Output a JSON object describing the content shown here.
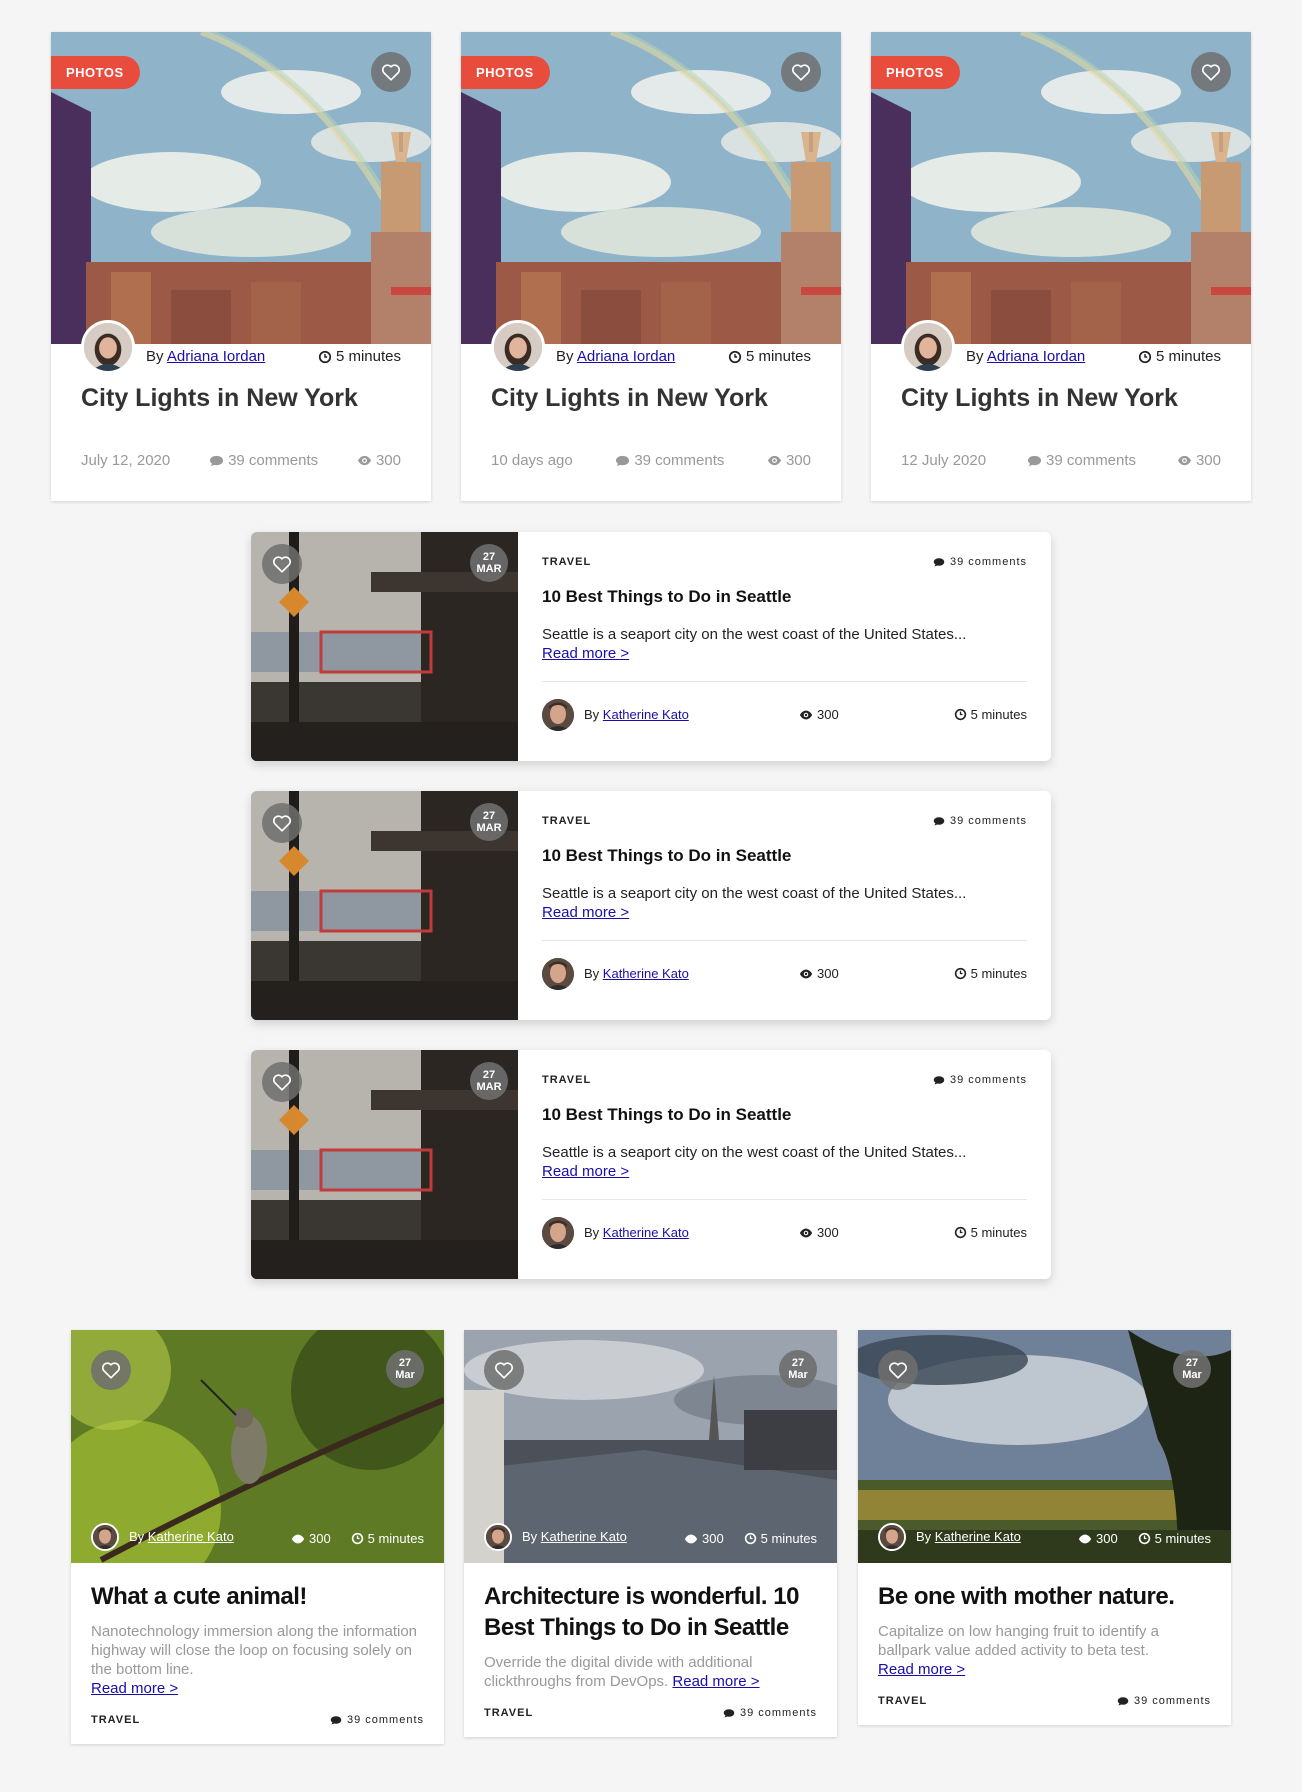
{
  "top_cards": [
    {
      "badge": "PHOTOS",
      "by": "By",
      "author": "Adriana Iordan",
      "read_time": "5 minutes",
      "title": "City Lights in New York",
      "date": "July 12, 2020",
      "comments": "39 comments",
      "views": "300"
    },
    {
      "badge": "PHOTOS",
      "by": "By",
      "author": "Adriana Iordan",
      "read_time": "5 minutes",
      "title": "City Lights in New York",
      "date": "10 days ago",
      "comments": "39 comments",
      "views": "300"
    },
    {
      "badge": "PHOTOS",
      "by": "By",
      "author": "Adriana Iordan",
      "read_time": "5 minutes",
      "title": "City Lights in New York",
      "date": "12 July 2020",
      "comments": "39 comments",
      "views": "300"
    }
  ],
  "horizontal_cards": [
    {
      "category": "TRAVEL",
      "comments": "39 comments",
      "title": "10 Best Things to Do in Seattle",
      "excerpt": "Seattle is a seaport city on the west coast of the United States...",
      "read_more": "Read more >",
      "by": "By",
      "author": "Katherine Kato",
      "views": "300",
      "read_time": "5 minutes",
      "date_day": "27",
      "date_month": "MAR"
    },
    {
      "category": "TRAVEL",
      "comments": "39 comments",
      "title": "10 Best Things to Do in Seattle",
      "excerpt": "Seattle is a seaport city on the west coast of the United States...",
      "read_more": "Read more >",
      "by": "By",
      "author": "Katherine Kato",
      "views": "300",
      "read_time": "5 minutes",
      "date_day": "27",
      "date_month": "MAR"
    },
    {
      "category": "TRAVEL",
      "comments": "39 comments",
      "title": "10 Best Things to Do in Seattle",
      "excerpt": "Seattle is a seaport city on the west coast of the United States...",
      "read_more": "Read more >",
      "by": "By",
      "author": "Katherine Kato",
      "views": "300",
      "read_time": "5 minutes",
      "date_day": "27",
      "date_month": "MAR"
    }
  ],
  "bottom_cards": [
    {
      "title": "What a cute animal!",
      "excerpt": "Nanotechnology immersion along the information highway will close the loop on focusing solely on the bottom line.",
      "read_more": "Read more >",
      "category": "TRAVEL",
      "comments": "39 comments",
      "by": "By",
      "author": "Katherine Kato",
      "views": "300",
      "read_time": "5 minutes",
      "date_day": "27",
      "date_month": "Mar"
    },
    {
      "title": "Architecture is wonderful. 10 Best Things to Do in Seattle",
      "excerpt": "Override the digital divide with additional clickthroughs from DevOps.",
      "read_more": "Read more >",
      "category": "TRAVEL",
      "comments": "39 comments",
      "by": "By",
      "author": "Katherine Kato",
      "views": "300",
      "read_time": "5 minutes",
      "date_day": "27",
      "date_month": "Mar"
    },
    {
      "title": "Be one with mother nature.",
      "excerpt": "Capitalize on low hanging fruit to identify a ballpark value added activity to beta test.",
      "read_more": "Read more >",
      "category": "TRAVEL",
      "comments": "39 comments",
      "by": "By",
      "author": "Katherine Kato",
      "views": "300",
      "read_time": "5 minutes",
      "date_day": "27",
      "date_month": "Mar"
    }
  ],
  "colors": {
    "badge": "#e74c3c",
    "link": "#1a0dab",
    "muted": "#999999",
    "background": "#f5f5f5"
  },
  "icons": [
    "heart-icon",
    "clock-icon",
    "comment-icon",
    "eye-icon"
  ]
}
